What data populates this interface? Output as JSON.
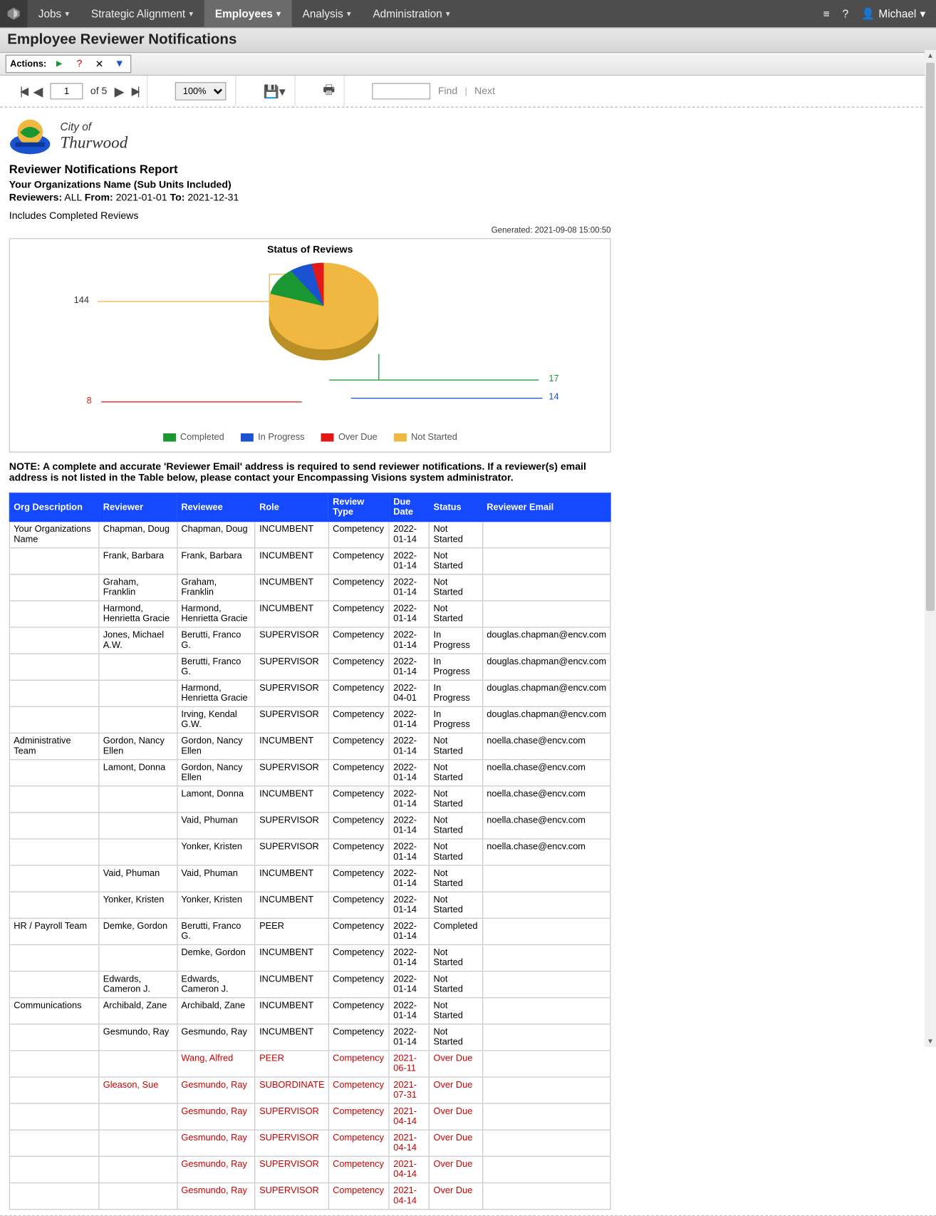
{
  "nav": {
    "items": [
      "Jobs",
      "Strategic Alignment",
      "Employees",
      "Analysis",
      "Administration"
    ],
    "active_index": 2,
    "user": "Michael"
  },
  "page_title": "Employee Reviewer Notifications",
  "actions": {
    "label": "Actions:"
  },
  "viewer": {
    "page_current": "1",
    "page_of": "of 5",
    "zoom": "100%",
    "find_label": "Find",
    "next_label": "Next"
  },
  "logo": {
    "line1": "City of",
    "line2": "Thurwood"
  },
  "report": {
    "title": "Reviewer Notifications Report",
    "org": "Your Organizations Name (Sub Units Included)",
    "filters_label_reviewers": "Reviewers:",
    "filters_reviewers": "ALL",
    "filters_from_label": "From:",
    "filters_from": "2021-01-01",
    "filters_to_label": "To:",
    "filters_to": "2021-12-31",
    "includes": "Includes Completed Reviews",
    "generated": "Generated: 2021-09-08 15:00:50",
    "note": "NOTE: A complete and accurate 'Reviewer Email' address is required to send reviewer notifications.  If a reviewer(s) email address is not listed in the Table below, please contact your Encompassing Visions system administrator."
  },
  "chart_data": {
    "type": "pie",
    "title": "Status of Reviews",
    "series": [
      {
        "name": "Completed",
        "value": 17,
        "color": "#1a9632"
      },
      {
        "name": "In Progress",
        "value": 14,
        "color": "#1a52d0"
      },
      {
        "name": "Over Due",
        "value": 8,
        "color": "#e01818"
      },
      {
        "name": "Not Started",
        "value": 144,
        "color": "#f0b840"
      }
    ],
    "legend": [
      "Completed",
      "In Progress",
      "Over Due",
      "Not Started"
    ],
    "callouts": {
      "Not Started": 144,
      "Completed": 17,
      "In Progress": 14,
      "Over Due": 8
    }
  },
  "table": {
    "headers": [
      "Org Description",
      "Reviewer",
      "Reviewee",
      "Role",
      "Review Type",
      "Due Date",
      "Status",
      "Reviewer Email"
    ],
    "rows": [
      {
        "org": "Your Organizations Name",
        "reviewer": "Chapman, Doug",
        "reviewee": "Chapman, Doug",
        "role": "INCUMBENT",
        "type": "Competency",
        "due": "2022-01-14",
        "status": "Not Started",
        "email": ""
      },
      {
        "org": "",
        "reviewer": "Frank, Barbara",
        "reviewee": "Frank, Barbara",
        "role": "INCUMBENT",
        "type": "Competency",
        "due": "2022-01-14",
        "status": "Not Started",
        "email": ""
      },
      {
        "org": "",
        "reviewer": "Graham, Franklin",
        "reviewee": "Graham, Franklin",
        "role": "INCUMBENT",
        "type": "Competency",
        "due": "2022-01-14",
        "status": "Not Started",
        "email": ""
      },
      {
        "org": "",
        "reviewer": "Harmond, Henrietta Gracie",
        "reviewee": "Harmond, Henrietta Gracie",
        "role": "INCUMBENT",
        "type": "Competency",
        "due": "2022-01-14",
        "status": "Not Started",
        "email": ""
      },
      {
        "org": "",
        "reviewer": "Jones, Michael A.W.",
        "reviewee": "Berutti, Franco G.",
        "role": "SUPERVISOR",
        "type": "Competency",
        "due": "2022-01-14",
        "status": "In Progress",
        "email": "douglas.chapman@encv.com"
      },
      {
        "org": "",
        "reviewer": "",
        "reviewee": "Berutti, Franco G.",
        "role": "SUPERVISOR",
        "type": "Competency",
        "due": "2022-01-14",
        "status": "In Progress",
        "email": "douglas.chapman@encv.com"
      },
      {
        "org": "",
        "reviewer": "",
        "reviewee": "Harmond, Henrietta Gracie",
        "role": "SUPERVISOR",
        "type": "Competency",
        "due": "2022-04-01",
        "status": "In Progress",
        "email": "douglas.chapman@encv.com"
      },
      {
        "org": "",
        "reviewer": "",
        "reviewee": "Irving, Kendal G.W.",
        "role": "SUPERVISOR",
        "type": "Competency",
        "due": "2022-01-14",
        "status": "In Progress",
        "email": "douglas.chapman@encv.com"
      },
      {
        "org": "Administrative Team",
        "reviewer": "Gordon, Nancy Ellen",
        "reviewee": "Gordon, Nancy Ellen",
        "role": "INCUMBENT",
        "type": "Competency",
        "due": "2022-01-14",
        "status": "Not Started",
        "email": "noella.chase@encv.com"
      },
      {
        "org": "",
        "reviewer": "Lamont, Donna",
        "reviewee": "Gordon, Nancy Ellen",
        "role": "SUPERVISOR",
        "type": "Competency",
        "due": "2022-01-14",
        "status": "Not Started",
        "email": "noella.chase@encv.com"
      },
      {
        "org": "",
        "reviewer": "",
        "reviewee": "Lamont, Donna",
        "role": "INCUMBENT",
        "type": "Competency",
        "due": "2022-01-14",
        "status": "Not Started",
        "email": "noella.chase@encv.com"
      },
      {
        "org": "",
        "reviewer": "",
        "reviewee": "Vaid, Phuman",
        "role": "SUPERVISOR",
        "type": "Competency",
        "due": "2022-01-14",
        "status": "Not Started",
        "email": "noella.chase@encv.com"
      },
      {
        "org": "",
        "reviewer": "",
        "reviewee": "Yonker, Kristen",
        "role": "SUPERVISOR",
        "type": "Competency",
        "due": "2022-01-14",
        "status": "Not Started",
        "email": "noella.chase@encv.com"
      },
      {
        "org": "",
        "reviewer": "Vaid, Phuman",
        "reviewee": "Vaid, Phuman",
        "role": "INCUMBENT",
        "type": "Competency",
        "due": "2022-01-14",
        "status": "Not Started",
        "email": ""
      },
      {
        "org": "",
        "reviewer": "Yonker, Kristen",
        "reviewee": "Yonker, Kristen",
        "role": "INCUMBENT",
        "type": "Competency",
        "due": "2022-01-14",
        "status": "Not Started",
        "email": ""
      },
      {
        "org": "HR / Payroll Team",
        "reviewer": "Demke, Gordon",
        "reviewee": "Berutti, Franco G.",
        "role": "PEER",
        "type": "Competency",
        "due": "2022-01-14",
        "status": "Completed",
        "email": ""
      },
      {
        "org": "",
        "reviewer": "",
        "reviewee": "Demke, Gordon",
        "role": "INCUMBENT",
        "type": "Competency",
        "due": "2022-01-14",
        "status": "Not Started",
        "email": ""
      },
      {
        "org": "",
        "reviewer": "Edwards, Cameron J.",
        "reviewee": "Edwards, Cameron J.",
        "role": "INCUMBENT",
        "type": "Competency",
        "due": "2022-01-14",
        "status": "Not Started",
        "email": ""
      },
      {
        "org": "Communications",
        "reviewer": "Archibald, Zane",
        "reviewee": "Archibald, Zane",
        "role": "INCUMBENT",
        "type": "Competency",
        "due": "2022-01-14",
        "status": "Not Started",
        "email": ""
      },
      {
        "org": "",
        "reviewer": "Gesmundo, Ray",
        "reviewee": "Gesmundo, Ray",
        "role": "INCUMBENT",
        "type": "Competency",
        "due": "2022-01-14",
        "status": "Not Started",
        "email": ""
      },
      {
        "org": "",
        "reviewer": "",
        "reviewee": "Wang, Alfred",
        "role": "PEER",
        "type": "Competency",
        "due": "2021-06-11",
        "status": "Over Due",
        "email": "",
        "overdue": true
      },
      {
        "org": "",
        "reviewer": "Gleason, Sue",
        "reviewee": "Gesmundo, Ray",
        "role": "SUBORDINATE",
        "type": "Competency",
        "due": "2021-07-31",
        "status": "Over Due",
        "email": "",
        "overdue": true
      },
      {
        "org": "",
        "reviewer": "",
        "reviewee": "Gesmundo, Ray",
        "role": "SUPERVISOR",
        "type": "Competency",
        "due": "2021-04-14",
        "status": "Over Due",
        "email": "",
        "overdue": true
      },
      {
        "org": "",
        "reviewer": "",
        "reviewee": "Gesmundo, Ray",
        "role": "SUPERVISOR",
        "type": "Competency",
        "due": "2021-04-14",
        "status": "Over Due",
        "email": "",
        "overdue": true
      },
      {
        "org": "",
        "reviewer": "",
        "reviewee": "Gesmundo, Ray",
        "role": "SUPERVISOR",
        "type": "Competency",
        "due": "2021-04-14",
        "status": "Over Due",
        "email": "",
        "overdue": true
      },
      {
        "org": "",
        "reviewer": "",
        "reviewee": "Gesmundo, Ray",
        "role": "SUPERVISOR",
        "type": "Competency",
        "due": "2021-04-14",
        "status": "Over Due",
        "email": "",
        "overdue": true
      }
    ]
  }
}
